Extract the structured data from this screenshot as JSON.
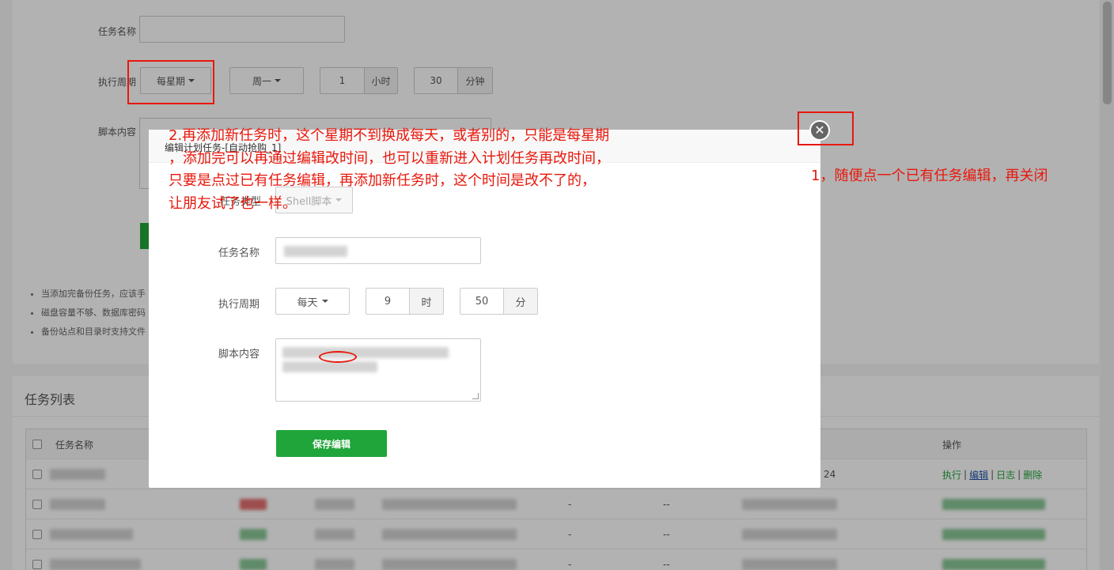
{
  "background_form": {
    "task_name_label": "任务名称",
    "period_label": "执行周期",
    "period_type": "每星期",
    "weekday": "周一",
    "hour_value": "1",
    "hour_unit": "小时",
    "minute_value": "30",
    "minute_unit": "分钟",
    "script_label": "脚本内容",
    "tips": [
      "当添加完备份任务，应该手",
      "磁盘容量不够、数据库密码",
      "备份站点和目录时支持文件"
    ]
  },
  "task_list": {
    "title": "任务列表",
    "columns": {
      "name": "任务名称",
      "ops": "操作"
    },
    "row1": {
      "time_suffix": "24",
      "op_exec": "执行",
      "op_edit": "编辑",
      "op_log": "日志",
      "op_delete": "删除",
      "sep": "|"
    },
    "rows_dash": "-",
    "rows_dashdash": "--"
  },
  "modal": {
    "title": "编辑计划任务-[自动抢购_1]",
    "task_type_label": "任务类型",
    "task_type_value": "Shell脚本",
    "task_name_label": "任务名称",
    "period_label": "执行周期",
    "period_type": "每天",
    "hour_value": "9",
    "hour_unit": "时",
    "minute_value": "50",
    "minute_unit": "分",
    "script_label": "脚本内容",
    "save_button": "保存编辑",
    "close_glyph": "✕"
  },
  "annotations": {
    "note1": "1，随便点一个已有任务编辑，再关闭",
    "note2_line1": "2.再添加新任务时，这个星期不到换成每天，或者别的，只能是每星期",
    "note2_line2": "，添加完可以再通过编辑改时间，也可以重新进入计划任务再改时间，",
    "note2_line3": "只要是点过已有任务编辑，再添加新任务时，这个时间是改不了的，",
    "note2_line4": "让朋友试了也一样。"
  },
  "colors": {
    "accent_green": "#20a53a",
    "annotation_red": "#e8180c",
    "link_blue": "#2255aa"
  }
}
